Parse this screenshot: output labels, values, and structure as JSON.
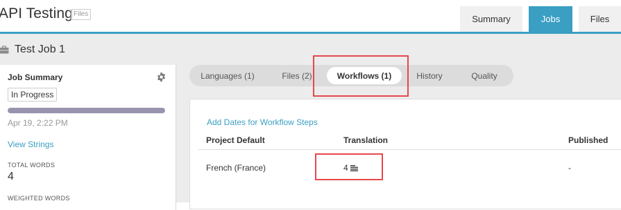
{
  "header": {
    "app_title": "API Testing",
    "badge": "Files",
    "tabs": [
      {
        "label": "Summary",
        "active": false
      },
      {
        "label": "Jobs",
        "active": true
      },
      {
        "label": "Files",
        "active": false
      }
    ]
  },
  "job": {
    "title": "Test Job 1",
    "icon": "briefcase-icon"
  },
  "summary": {
    "title": "Job Summary",
    "settings_icon": "gear-icon",
    "status": "In Progress",
    "progress": 1.0,
    "date": "Apr 19, 2:22 PM",
    "view_strings": "View Strings",
    "total_words_label": "TOTAL WORDS",
    "total_words": "4",
    "weighted_words_label": "WEIGHTED WORDS"
  },
  "subtabs": [
    {
      "label": "Languages (1)",
      "active": false
    },
    {
      "label": "Files (2)",
      "active": false
    },
    {
      "label": "Workflows (1)",
      "active": true
    },
    {
      "label": "History",
      "active": false
    },
    {
      "label": "Quality",
      "active": false
    }
  ],
  "workflows": {
    "add_dates_link": "Add Dates for Workflow Steps",
    "columns": [
      "Project Default",
      "Translation",
      "Published"
    ],
    "rows": [
      {
        "language": "French (France)",
        "translation": "4",
        "translation_icon": "lines-icon",
        "published": "-"
      }
    ]
  },
  "colors": {
    "accent": "#3a9fc2",
    "highlight": "#e8474a",
    "progress": "#9a93ae"
  }
}
